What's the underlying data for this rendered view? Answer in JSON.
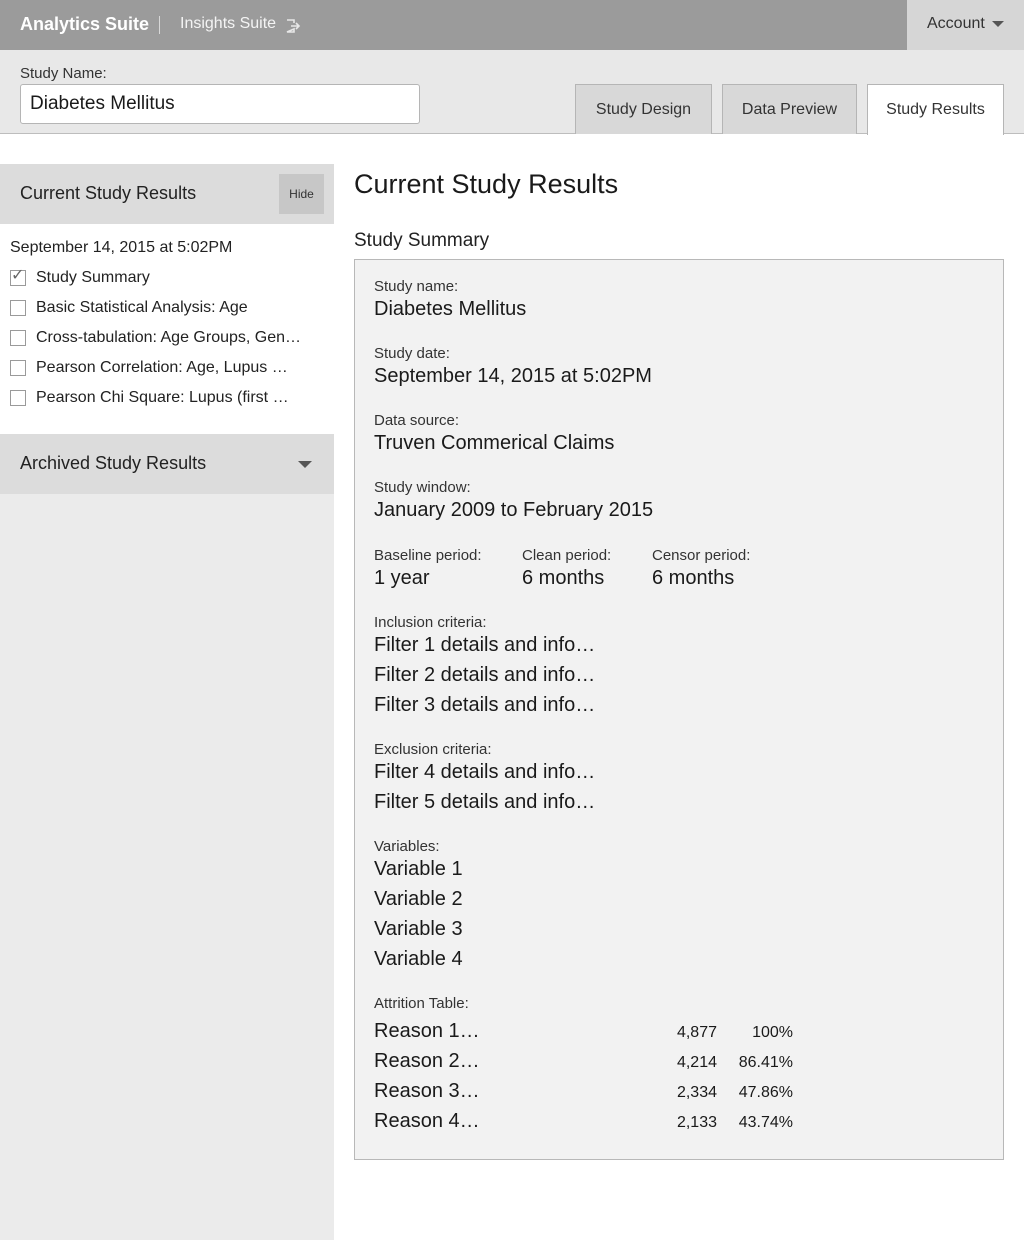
{
  "topbar": {
    "brand": "Analytics Suite",
    "insights": "Insights Suite",
    "account": "Account"
  },
  "study": {
    "name_label": "Study Name:",
    "name_value": "Diabetes Mellitus"
  },
  "tabs": [
    {
      "label": "Study Design",
      "active": false
    },
    {
      "label": "Data Preview",
      "active": false
    },
    {
      "label": "Study Results",
      "active": true
    }
  ],
  "sidebar": {
    "current_title": "Current Study Results",
    "hide_label": "Hide",
    "date": "September 14, 2015 at 5:02PM",
    "items": [
      {
        "label": "Study Summary",
        "checked": true
      },
      {
        "label": "Basic Statistical Analysis: Age",
        "checked": false
      },
      {
        "label": "Cross-tabulation: Age Groups, Gen…",
        "checked": false
      },
      {
        "label": "Pearson Correlation: Age, Lupus …",
        "checked": false
      },
      {
        "label": "Pearson Chi Square: Lupus (first …",
        "checked": false
      }
    ],
    "archived_title": "Archived Study Results"
  },
  "main": {
    "title": "Current Study Results",
    "section_title": "Study Summary",
    "summary": {
      "name_label": "Study name:",
      "name_value": "Diabetes Mellitus",
      "date_label": "Study date:",
      "date_value": "September 14, 2015 at 5:02PM",
      "source_label": "Data source:",
      "source_value": "Truven Commerical Claims",
      "window_label": "Study window:",
      "window_value": "January 2009 to February 2015",
      "baseline_label": "Baseline period:",
      "baseline_value": "1 year",
      "clean_label": "Clean period:",
      "clean_value": "6 months",
      "censor_label": "Censor period:",
      "censor_value": "6 months",
      "inclusion_label": "Inclusion criteria:",
      "inclusion": [
        "Filter 1 details and info…",
        "Filter 2 details and info…",
        "Filter 3 details and info…"
      ],
      "exclusion_label": "Exclusion criteria:",
      "exclusion": [
        "Filter 4 details and info…",
        "Filter 5 details and info…"
      ],
      "variables_label": "Variables:",
      "variables": [
        "Variable 1",
        "Variable 2",
        "Variable 3",
        "Variable 4"
      ],
      "attrition_label": "Attrition Table:",
      "attrition": [
        {
          "reason": "Reason 1…",
          "count": "4,877",
          "pct": "100%"
        },
        {
          "reason": "Reason 2…",
          "count": "4,214",
          "pct": "86.41%"
        },
        {
          "reason": "Reason 3…",
          "count": "2,334",
          "pct": "47.86%"
        },
        {
          "reason": "Reason 4…",
          "count": "2,133",
          "pct": "43.74%"
        }
      ]
    }
  }
}
